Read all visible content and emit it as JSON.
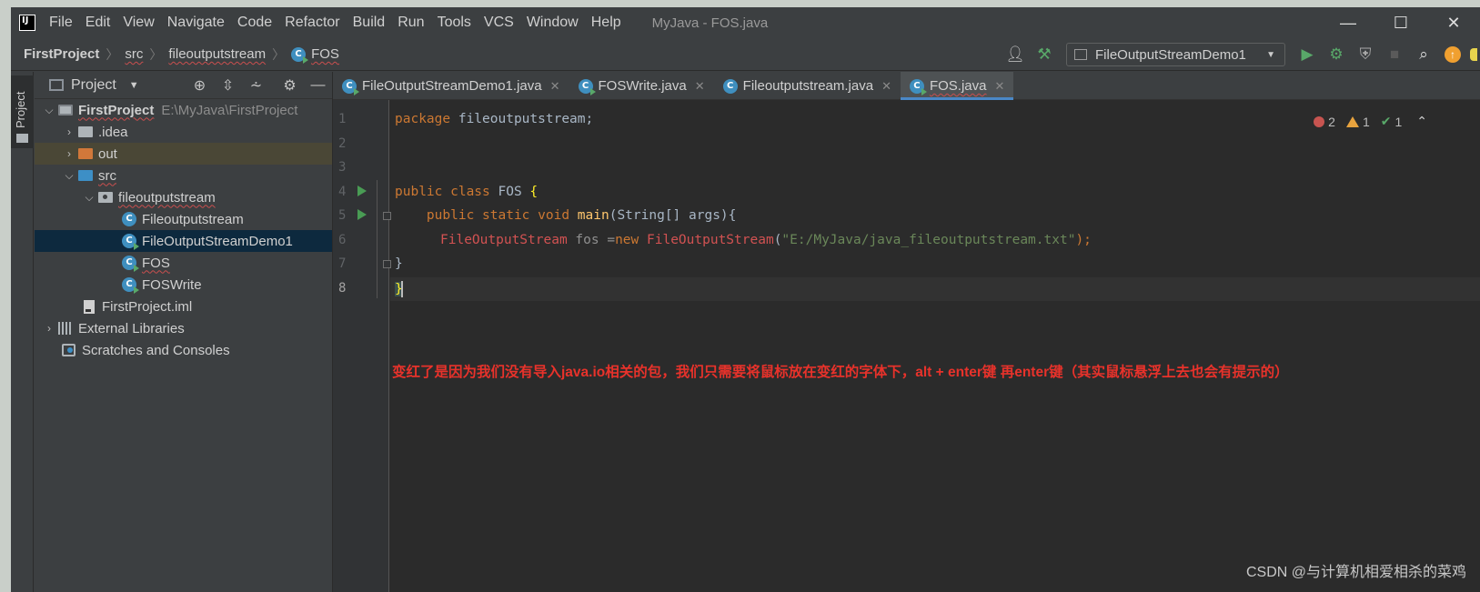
{
  "app": {
    "window_title": "MyJava - FOS.java",
    "menu": [
      "File",
      "Edit",
      "View",
      "Navigate",
      "Code",
      "Refactor",
      "Build",
      "Run",
      "Tools",
      "VCS",
      "Window",
      "Help"
    ],
    "controls": {
      "minimize": "—",
      "maximize": "☐",
      "close": "✕"
    }
  },
  "breadcrumb": {
    "items": [
      "FirstProject",
      "src",
      "fileoutputstream",
      "FOS"
    ],
    "separator": "〉"
  },
  "toolbar": {
    "run_config": "FileOutputStreamDemo1",
    "icons": [
      "user-icon",
      "hammer-icon",
      "run-icon",
      "debug-icon",
      "coverage-icon",
      "stop-icon",
      "search-icon",
      "update-icon"
    ]
  },
  "sidebar": {
    "project_tab_label": "Project"
  },
  "project_panel": {
    "title": "Project",
    "tree": [
      {
        "label": "FirstProject",
        "path": "E:\\MyJava\\FirstProject",
        "depth": 0,
        "expanded": true
      },
      {
        "label": ".idea",
        "depth": 1,
        "expanded": false
      },
      {
        "label": "out",
        "depth": 1,
        "expanded": false,
        "highlighted": true
      },
      {
        "label": "src",
        "depth": 1,
        "expanded": true
      },
      {
        "label": "fileoutputstream",
        "depth": 2,
        "expanded": true
      },
      {
        "label": "Fileoutputstream",
        "depth": 3
      },
      {
        "label": "FileOutputStreamDemo1",
        "depth": 3,
        "selected": true
      },
      {
        "label": "FOS",
        "depth": 3
      },
      {
        "label": "FOSWrite",
        "depth": 3
      },
      {
        "label": "FirstProject.iml",
        "depth": 2
      },
      {
        "label": "External Libraries",
        "depth": 0
      },
      {
        "label": "Scratches and Consoles",
        "depth": 0
      }
    ]
  },
  "tabs": [
    {
      "label": "FileOutputStreamDemo1.java",
      "active": false
    },
    {
      "label": "FOSWrite.java",
      "active": false
    },
    {
      "label": "Fileoutputstream.java",
      "active": false
    },
    {
      "label": "FOS.java",
      "active": true
    }
  ],
  "editor": {
    "line_numbers": [
      "1",
      "2",
      "3",
      "4",
      "5",
      "6",
      "7",
      "8"
    ],
    "code": {
      "l1_kw": "package",
      "l1_rest": " fileoutputstream;",
      "l4_kw": "public class",
      "l4_name": " FOS ",
      "l4_brace": "{",
      "l5_kw": "    public static void",
      "l5_fn": " main",
      "l5_rest": "(String[] args){",
      "l6_type": "FileOutputStream",
      "l6_var": " fos =",
      "l6_new": "new",
      "l6_ctor": " FileOutputStream",
      "l6_open": "(",
      "l6_str": "\"E:/MyJava/java_fileoutputstream.txt\"",
      "l6_close": ");",
      "l7": "}",
      "l8": "}"
    },
    "inspections": {
      "errors": "2",
      "warnings": "1",
      "ok": "1"
    },
    "note": "变红了是因为我们没有导入java.io相关的包，我们只需要将鼠标放在变红的字体下，alt + enter键 再enter键（其实鼠标悬浮上去也会有提示的）"
  },
  "watermark": "CSDN @与计算机相爱相杀的菜鸡",
  "colors": {
    "accent": "#4a88c7",
    "keyword": "#cc7832",
    "string": "#6a8759",
    "error": "#d25252",
    "note": "#e8322b"
  }
}
